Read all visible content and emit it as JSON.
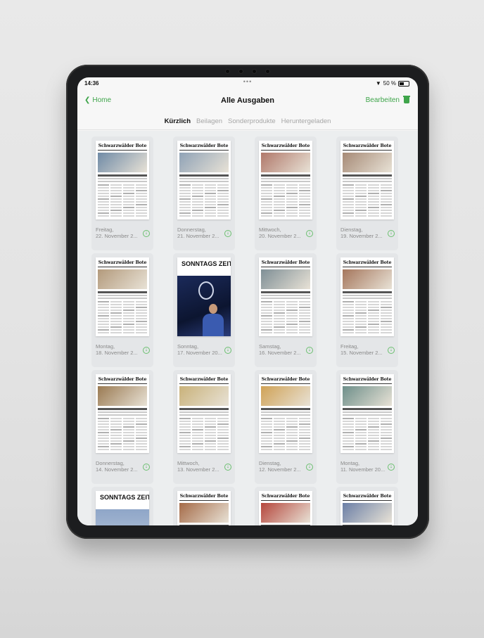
{
  "status": {
    "time": "14:36",
    "dots": "•••",
    "signal": "50 %"
  },
  "nav": {
    "back_label": "Home",
    "title": "Alle Ausgaben",
    "edit_label": "Bearbeiten"
  },
  "tabs": [
    {
      "label": "Kürzlich",
      "active": true
    },
    {
      "label": "Beilagen",
      "active": false
    },
    {
      "label": "Sonderprodukte",
      "active": false
    },
    {
      "label": "Heruntergeladen",
      "active": false
    }
  ],
  "masthead": "Schwarzwälder Bote",
  "sonntag_title": "SONNTAGS ZEITUNG",
  "issues": [
    {
      "kind": "bote",
      "date1": "Freitag,",
      "date2": "22. November 2...",
      "photo": "#6f8aa6"
    },
    {
      "kind": "bote",
      "date1": "Donnerstag,",
      "date2": "21. November 2...",
      "photo": "#8fa2b6"
    },
    {
      "kind": "bote",
      "date1": "Mittwoch,",
      "date2": "20. November 2...",
      "photo": "#b0786a"
    },
    {
      "kind": "bote",
      "date1": "Dienstag,",
      "date2": "19. November 2...",
      "photo": "#a68a76"
    },
    {
      "kind": "bote",
      "date1": "Montag,",
      "date2": "18. November 2...",
      "photo": "#b39a7c"
    },
    {
      "kind": "sonntag",
      "date1": "Sonntag,",
      "date2": "17. November 20...",
      "photo": "#1b2a5a"
    },
    {
      "kind": "bote",
      "date1": "Samstag,",
      "date2": "16. November 2...",
      "photo": "#7f8f96"
    },
    {
      "kind": "bote",
      "date1": "Freitag,",
      "date2": "15. November 2...",
      "photo": "#a5765c"
    },
    {
      "kind": "bote",
      "date1": "Donnerstag,",
      "date2": "14. November 2...",
      "photo": "#9a7a52"
    },
    {
      "kind": "bote",
      "date1": "Mittwoch,",
      "date2": "13. November 2...",
      "photo": "#c9b27a"
    },
    {
      "kind": "bote",
      "date1": "Dienstag,",
      "date2": "12. November 2...",
      "photo": "#d0a256"
    },
    {
      "kind": "bote",
      "date1": "Montag,",
      "date2": "11. November 20...",
      "photo": "#6e8f8a"
    },
    {
      "kind": "sonntag-partial",
      "date1": "",
      "date2": "",
      "photo": "#8fa6c8"
    },
    {
      "kind": "bote",
      "date1": "",
      "date2": "",
      "photo": "#a56b48"
    },
    {
      "kind": "bote",
      "date1": "",
      "date2": "",
      "photo": "#b5463c"
    },
    {
      "kind": "bote",
      "date1": "",
      "date2": "",
      "photo": "#6b7fa6"
    }
  ],
  "colors": {
    "accent": "#3fa54b",
    "bezel": "#1c1d1f",
    "screen_bg": "#f7f7f7"
  },
  "icons": {
    "back": "chevron-left-icon",
    "trash": "trash-icon",
    "download": "download-icon",
    "wifi": "wifi-icon",
    "battery": "battery-icon"
  }
}
